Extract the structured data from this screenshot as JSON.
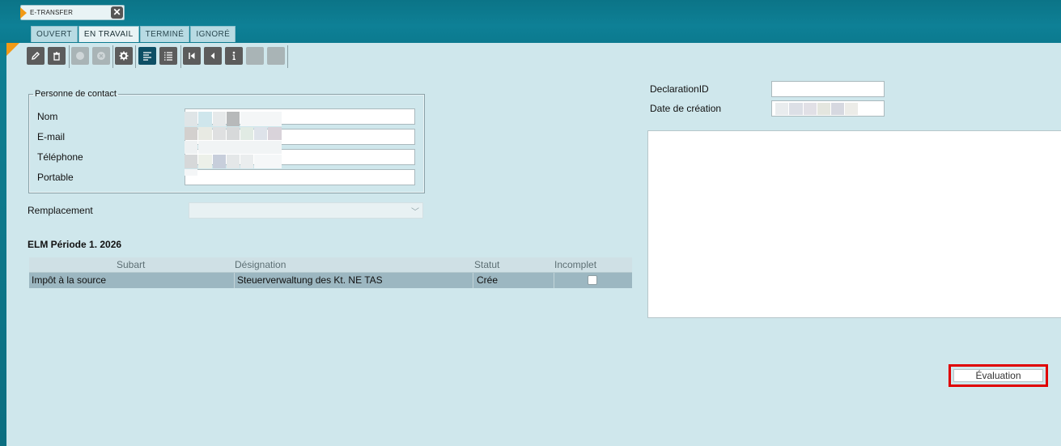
{
  "document_tab": {
    "title": "E-TRANSFER",
    "close_icon": "close-icon"
  },
  "state_tabs": [
    {
      "label": "OUVERT"
    },
    {
      "label": "EN TRAVAIL"
    },
    {
      "label": "TERMINÉ"
    },
    {
      "label": "IGNORÉ"
    }
  ],
  "active_state_tab": "EN TRAVAIL",
  "toolbar": {
    "buttons": [
      {
        "icon": "pencil-icon",
        "state": "enabled"
      },
      {
        "icon": "trash-icon",
        "state": "enabled"
      },
      {
        "icon": "circle-icon",
        "state": "disabled"
      },
      {
        "icon": "circle-x-icon",
        "state": "disabled"
      },
      {
        "icon": "gear-icon",
        "state": "enabled"
      },
      {
        "icon": "align-left-icon",
        "state": "active"
      },
      {
        "icon": "list-icon",
        "state": "enabled"
      },
      {
        "icon": "first-page-icon",
        "state": "enabled"
      },
      {
        "icon": "previous-icon",
        "state": "enabled"
      },
      {
        "icon": "info-icon",
        "state": "enabled"
      },
      {
        "icon": "blank-icon",
        "state": "disabled"
      },
      {
        "icon": "blank-icon",
        "state": "disabled"
      }
    ]
  },
  "contact": {
    "legend": "Personne de contact",
    "nom_label": "Nom",
    "email_label": "E-mail",
    "telephone_label": "Téléphone",
    "portable_label": "Portable"
  },
  "remplacement": {
    "label": "Remplacement",
    "value": ""
  },
  "period": {
    "title": "ELM Période 1. 2026",
    "columns": [
      "Subart",
      "Désignation",
      "Statut",
      "Incomplet"
    ],
    "rows": [
      {
        "subart": "Impôt à la source",
        "designation": "Steuerverwaltung des Kt. NE TAS",
        "statut": "Crée",
        "incomplet": false
      }
    ]
  },
  "declaration": {
    "id_label": "DeclarationID",
    "id_value": "",
    "date_label": "Date de création"
  },
  "evaluation_button": "Évaluation",
  "colors": {
    "topbar": "#0e8096",
    "background": "#cfe7ec",
    "accent_orange": "#f29a16",
    "highlight_red": "#e00000"
  }
}
